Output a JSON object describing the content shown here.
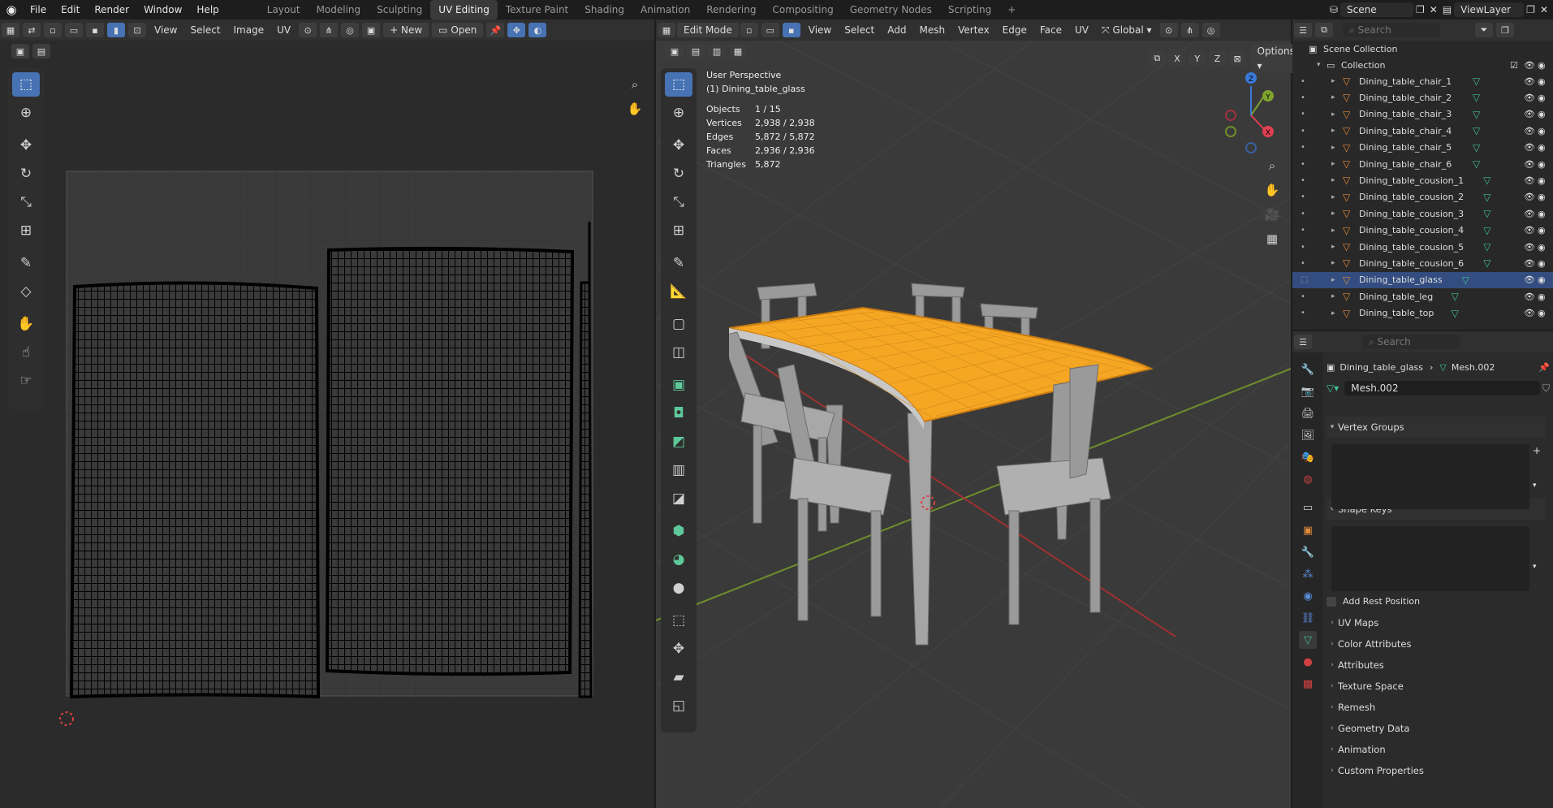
{
  "topbar": {
    "menus": [
      "File",
      "Edit",
      "Render",
      "Window",
      "Help"
    ],
    "workspaces": [
      "Layout",
      "Modeling",
      "Sculpting",
      "UV Editing",
      "Texture Paint",
      "Shading",
      "Animation",
      "Rendering",
      "Compositing",
      "Geometry Nodes",
      "Scripting"
    ],
    "active_workspace": "UV Editing",
    "scene": "Scene",
    "view_layer": "ViewLayer"
  },
  "uv_editor": {
    "header": {
      "view": "View",
      "select": "Select",
      "image": "Image",
      "uv": "UV",
      "new": "New",
      "open": "Open"
    }
  },
  "viewport": {
    "header": {
      "mode": "Edit Mode",
      "view": "View",
      "select": "Select",
      "add": "Add",
      "mesh": "Mesh",
      "vertex": "Vertex",
      "edge": "Edge",
      "face": "Face",
      "uv": "UV",
      "orientation": "Global",
      "options": "Options",
      "x": "X",
      "y": "Y",
      "z": "Z"
    },
    "overlay": {
      "perspective": "User Perspective",
      "object": "(1) Dining_table_glass",
      "stats": [
        {
          "k": "Objects",
          "v": "1 / 15"
        },
        {
          "k": "Vertices",
          "v": "2,938 / 2,938"
        },
        {
          "k": "Edges",
          "v": "5,872 / 5,872"
        },
        {
          "k": "Faces",
          "v": "2,936 / 2,936"
        },
        {
          "k": "Triangles",
          "v": "5,872"
        }
      ]
    },
    "gizmo": {
      "x": "X",
      "y": "Y",
      "z": "Z"
    }
  },
  "outliner": {
    "search_placeholder": "Search",
    "scene_collection": "Scene Collection",
    "collection": "Collection",
    "items": [
      "Dining_table_chair_1",
      "Dining_table_chair_2",
      "Dining_table_chair_3",
      "Dining_table_chair_4",
      "Dining_table_chair_5",
      "Dining_table_chair_6",
      "Dining_table_cousion_1",
      "Dining_table_cousion_2",
      "Dining_table_cousion_3",
      "Dining_table_cousion_4",
      "Dining_table_cousion_5",
      "Dining_table_cousion_6",
      "Dining_table_glass",
      "Dining_table_leg",
      "Dining_table_top"
    ],
    "selected_item": "Dining_table_glass"
  },
  "properties": {
    "search_placeholder": "Search",
    "object": "Dining_table_glass",
    "mesh": "Mesh.002",
    "mesh_field": "Mesh.002",
    "sections": [
      "Vertex Groups",
      "Shape Keys",
      "UV Maps",
      "Color Attributes",
      "Attributes",
      "Texture Space",
      "Remesh",
      "Geometry Data",
      "Animation",
      "Custom Properties"
    ],
    "add_rest_position": "Add Rest Position"
  },
  "colors": {
    "accent": "#4772b3",
    "selection": "#f5a623",
    "active_row": "#334d80",
    "mesh_icon": "#40c090",
    "object_icon": "#e08a3a"
  }
}
